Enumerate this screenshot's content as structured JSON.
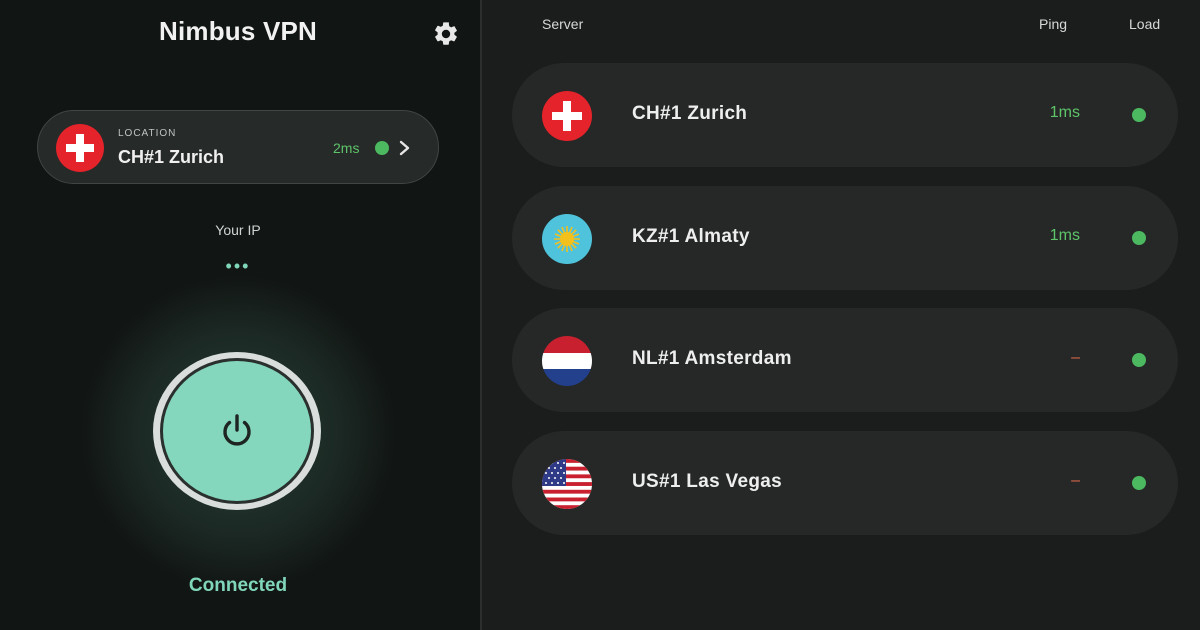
{
  "app": {
    "title": "Nimbus VPN"
  },
  "icons": {
    "settings": "gear-icon",
    "power": "power-icon",
    "chevron": "chevron-right-icon"
  },
  "colors": {
    "accent": "#84d6bc",
    "ping_good": "#5fc36a",
    "ping_none": "#d9694a",
    "load_ok": "#4cb860"
  },
  "location": {
    "caption": "LOCATION",
    "name": "CH#1 Zurich",
    "ping": "2ms",
    "flag": "switzerland"
  },
  "ip": {
    "label": "Your IP",
    "value": "•••"
  },
  "connection": {
    "status": "Connected"
  },
  "server_list": {
    "headers": {
      "server": "Server",
      "ping": "Ping",
      "load": "Load"
    },
    "servers": [
      {
        "name": "CH#1 Zurich",
        "ping": "1ms",
        "flag": "switzerland",
        "ping_status": "good"
      },
      {
        "name": "KZ#1 Almaty",
        "ping": "1ms",
        "flag": "kazakhstan",
        "ping_status": "good"
      },
      {
        "name": "NL#1 Amsterdam",
        "ping": "–",
        "flag": "netherlands",
        "ping_status": "none"
      },
      {
        "name": "US#1 Las Vegas",
        "ping": "–",
        "flag": "usa",
        "ping_status": "none"
      }
    ]
  }
}
